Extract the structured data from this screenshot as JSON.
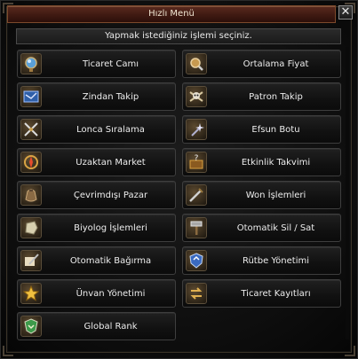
{
  "window": {
    "title": "Hızlı Menü",
    "close_glyph": "✕"
  },
  "subtitle": "Yapmak istediğiniz işlemi seçiniz.",
  "colors": {
    "title_bar": "#4a2016",
    "text": "#ededed",
    "button_border": "#3e3e3e",
    "icon_frame": "#5b4e3a"
  },
  "menu": {
    "left": [
      {
        "label": "Ticaret Camı",
        "icon": "magnifier-orb-icon"
      },
      {
        "label": "Zindan Takip",
        "icon": "blue-map-scroll-icon"
      },
      {
        "label": "Lonca Sıralama",
        "icon": "crossed-swords-icon"
      },
      {
        "label": "Uzaktan Market",
        "icon": "gold-compass-icon"
      },
      {
        "label": "Çevrimdışı Pazar",
        "icon": "coin-pouch-icon"
      },
      {
        "label": "Biyolog İşlemleri",
        "icon": "ore-stone-icon"
      },
      {
        "label": "Otomatik Bağırma",
        "icon": "quill-scroll-icon"
      },
      {
        "label": "Ünvan Yönetimi",
        "icon": "gold-star-icon"
      },
      {
        "label": "Global Rank",
        "icon": "green-crest-icon"
      }
    ],
    "right": [
      {
        "label": "Ortalama Fiyat",
        "icon": "magnifier-coin-icon"
      },
      {
        "label": "Patron Takip",
        "icon": "skull-crossbones-icon"
      },
      {
        "label": "Efsun Botu",
        "icon": "magic-wand-icon"
      },
      {
        "label": "Etkinlik Takvimi",
        "icon": "question-chest-icon"
      },
      {
        "label": "Won İşlemleri",
        "icon": "sword-scroll-icon"
      },
      {
        "label": "Otomatik Sil / Sat",
        "icon": "hammer-icon"
      },
      {
        "label": "Rütbe Yönetimi",
        "icon": "blue-shield-icon"
      },
      {
        "label": "Ticaret Kayıtları",
        "icon": "trade-arrows-icon"
      }
    ]
  }
}
